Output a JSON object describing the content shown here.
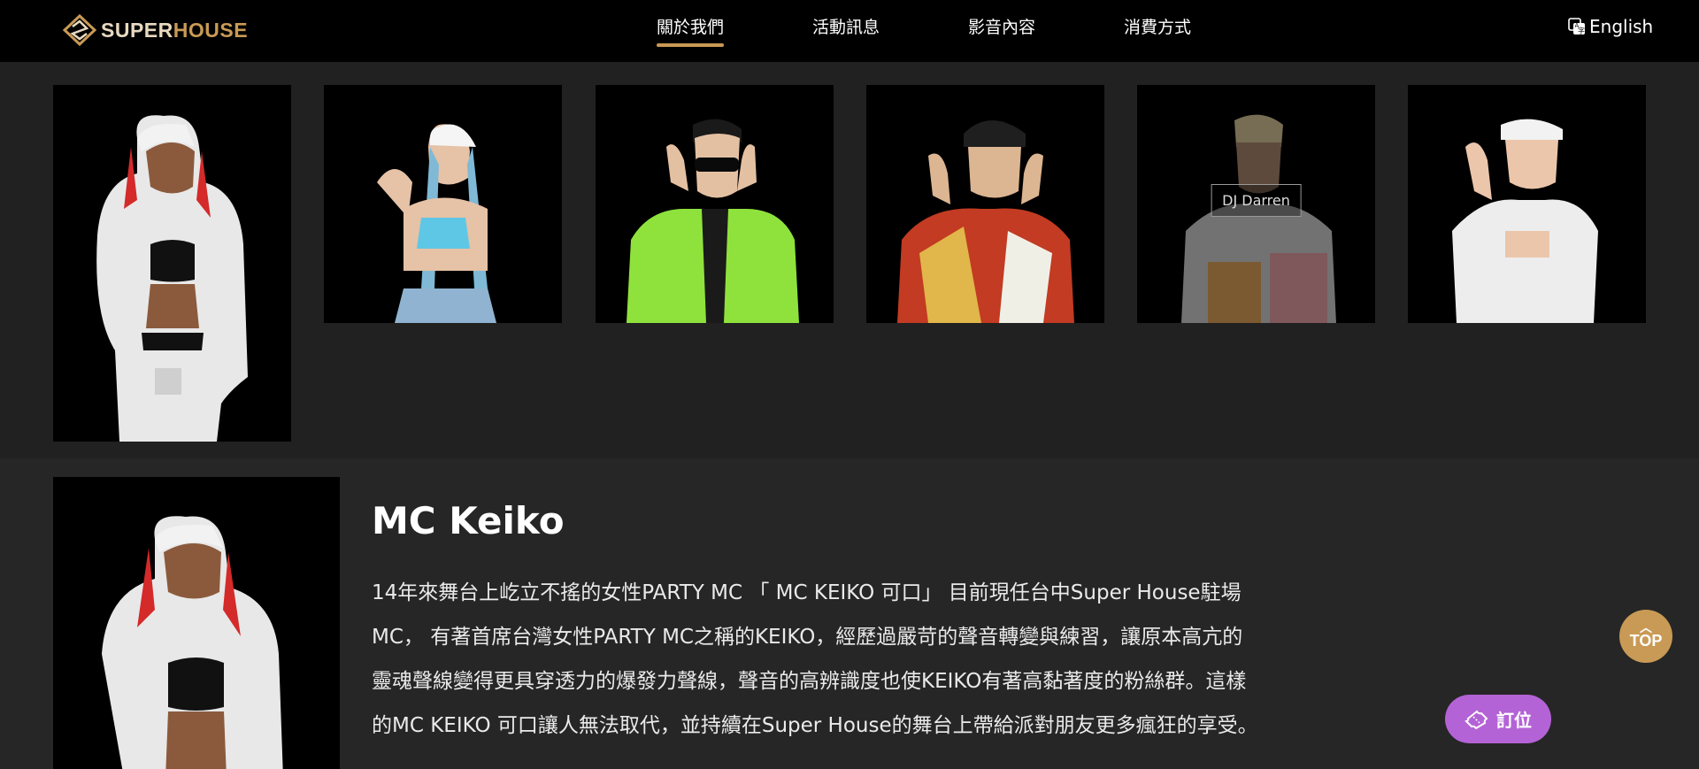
{
  "brand": {
    "logo_part1": "SUPER",
    "logo_part2": "HOUSE"
  },
  "nav": {
    "items": [
      {
        "label": "關於我們",
        "active": true
      },
      {
        "label": "活動訊息"
      },
      {
        "label": "影音內容"
      },
      {
        "label": "消費方式"
      }
    ],
    "language": "English"
  },
  "djs": [
    {
      "id": "keiko"
    },
    {
      "id": "dj-2"
    },
    {
      "id": "dj-3"
    },
    {
      "id": "dj-4"
    },
    {
      "id": "darren",
      "hover_label": "DJ Darren"
    },
    {
      "id": "dj-6"
    }
  ],
  "detail": {
    "name": "MC Keiko",
    "description": "14年來舞台上屹立不搖的女性PARTY MC 「 MC KEIKO 可口」 目前現任台中Super House駐場MC， 有著首席台灣女性PARTY MC之稱的KEIKO，經歷過嚴苛的聲音轉變與練習，讓原本高亢的靈魂聲線變得更具穿透力的爆發力聲線，聲音的高辨識度也使KEIKO有著高黏著度的粉絲群。這樣的MC KEIKO 可口讓人無法取代，並持續在Super House的舞台上帶給派對朋友更多瘋狂的享受。"
  },
  "floating": {
    "top_label": "TOP",
    "book_label": "訂位"
  },
  "colors": {
    "accent_gold": "#c99a55",
    "book_purple": "#b463d6",
    "background": "#212121"
  }
}
